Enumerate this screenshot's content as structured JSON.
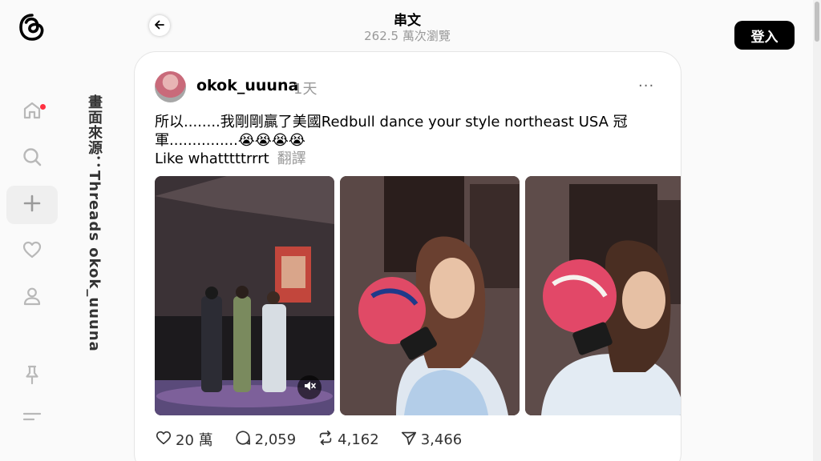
{
  "header": {
    "title": "串文",
    "views": "262.5 萬次瀏覽",
    "login_label": "登入"
  },
  "sidebar": {
    "items": [
      {
        "name": "home",
        "icon": "home-icon",
        "has_notification": true
      },
      {
        "name": "search",
        "icon": "search-icon"
      },
      {
        "name": "create",
        "icon": "plus-icon",
        "active": true
      },
      {
        "name": "activity",
        "icon": "heart-icon"
      },
      {
        "name": "profile",
        "icon": "user-icon"
      },
      {
        "name": "pinned",
        "icon": "pin-icon"
      },
      {
        "name": "menu",
        "icon": "menu-icon"
      }
    ]
  },
  "watermark": "畫面來源：Threads okok_uuuna",
  "post": {
    "username": "okok_uuuna",
    "time": "1天",
    "more": "···",
    "text_line1": "所以........我剛剛贏了美國Redbull dance your style northeast USA 冠",
    "text_line2": "軍...............😭😭😭😭",
    "text_line3": "Like whatttttrrrt",
    "translate": "翻譯",
    "media": [
      {
        "type": "video",
        "muted": true,
        "icon": "mute-icon"
      },
      {
        "type": "image"
      },
      {
        "type": "image"
      }
    ],
    "stats": {
      "likes": "20 萬",
      "comments": "2,059",
      "reposts": "4,162",
      "shares": "3,466"
    }
  },
  "colors": {
    "accent": "#000000",
    "notification": "#ff3040",
    "muted_text": "#999999"
  }
}
